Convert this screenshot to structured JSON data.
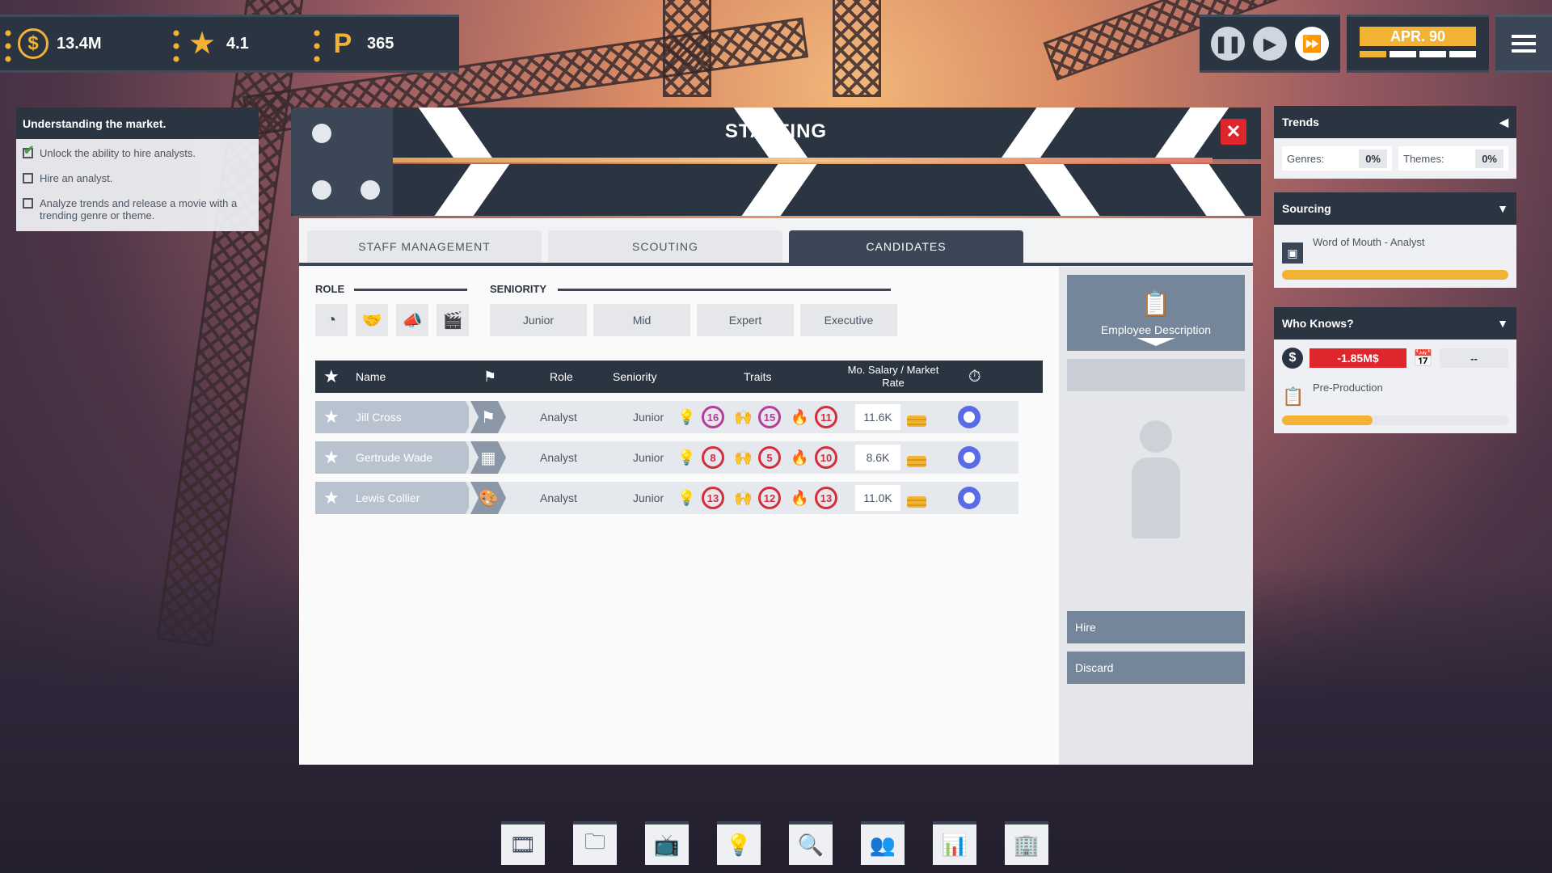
{
  "hud": {
    "money": "13.4M",
    "rating": "4.1",
    "points": "365",
    "date": "APR. 90",
    "date_progress": 0.2,
    "controls": [
      "pause",
      "play",
      "fast-forward"
    ]
  },
  "objectives": {
    "title": "Understanding the market.",
    "items": [
      {
        "label": "Unlock the ability to hire analysts.",
        "done": true
      },
      {
        "label": "Hire an analyst.",
        "done": false
      },
      {
        "label": "Analyze trends and release a movie with a trending genre or theme.",
        "done": false
      }
    ]
  },
  "dialog": {
    "title": "STAFFING",
    "tabs": [
      {
        "label": "STAFF MANAGEMENT",
        "active": false
      },
      {
        "label": "SCOUTING",
        "active": false
      },
      {
        "label": "CANDIDATES",
        "active": true
      }
    ],
    "filters": {
      "role_label": "ROLE",
      "seniority_label": "SENIORITY",
      "role_icons": [
        "analyst-icon",
        "producer-icon",
        "marketing-icon",
        "director-icon"
      ],
      "seniority_options": [
        "Junior",
        "Mid",
        "Expert",
        "Executive"
      ]
    },
    "table": {
      "headers": {
        "name": "Name",
        "role": "Role",
        "seniority": "Seniority",
        "traits": "Traits",
        "salary": "Mo. Salary / Market Rate"
      },
      "rows": [
        {
          "name": "Jill Cross",
          "source_icon": "flag-icon",
          "role": "Analyst",
          "seniority": "Junior",
          "traits": [
            16,
            15,
            11
          ],
          "salary": "11.6K"
        },
        {
          "name": "Gertrude Wade",
          "source_icon": "calendar-icon",
          "role": "Analyst",
          "seniority": "Junior",
          "traits": [
            8,
            5,
            10
          ],
          "salary": "8.6K"
        },
        {
          "name": "Lewis Collier",
          "source_icon": "palette-icon",
          "role": "Analyst",
          "seniority": "Junior",
          "traits": [
            13,
            12,
            13
          ],
          "salary": "11.0K"
        }
      ]
    },
    "side": {
      "description_label": "Employee Description",
      "hire_label": "Hire",
      "discard_label": "Discard"
    }
  },
  "trends": {
    "title": "Trends",
    "genres_label": "Genres:",
    "genres_value": "0%",
    "themes_label": "Themes:",
    "themes_value": "0%"
  },
  "sourcing": {
    "title": "Sourcing",
    "item_label": "Word of Mouth - Analyst",
    "progress": 1.0
  },
  "who_knows": {
    "title": "Who Knows?",
    "cost": "-1.85M$",
    "time": "--",
    "stage": "Pre-Production",
    "progress": 0.4
  },
  "bottom_bar": [
    "film-icon",
    "folder-icon",
    "tv-icon",
    "lightbulb-icon",
    "search-icon",
    "people-icon",
    "chart-icon",
    "building-icon"
  ],
  "colors": {
    "panel_dark": "#2b3542",
    "accent_yellow": "#f2b233",
    "danger_red": "#e0262d",
    "trait_red": "#d42d3b",
    "trait_purple": "#b63d9a"
  }
}
